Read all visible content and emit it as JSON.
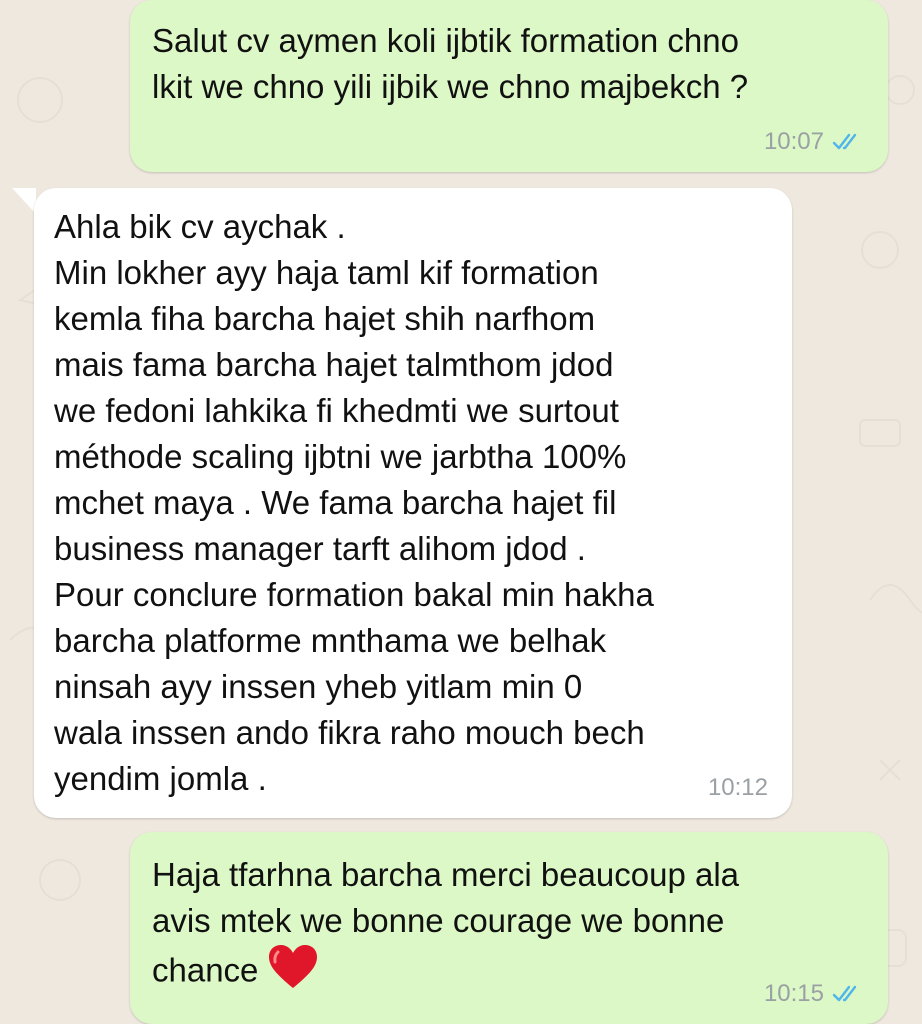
{
  "chat": {
    "messages": [
      {
        "direction": "outgoing",
        "text": "Salut cv aymen koli ijbtik formation chno\nlkit we chno yili ijbik we chno majbekch ?",
        "time": "10:07",
        "status_icon": "double-check-read-icon"
      },
      {
        "direction": "incoming",
        "text": "Ahla bik cv aychak .\nMin lokher ayy haja taml kif formation\nkemla fiha barcha hajet shih narfhom\nmais fama barcha hajet talmthom jdod\nwe fedoni lahkika fi khedmti we surtout\nméthode scaling ijbtni we jarbtha 100%\nmchet maya . We fama barcha hajet fil\nbusiness manager tarft alihom jdod .\nPour conclure formation bakal min hakha\nbarcha platforme mnthama we belhak\nninsah ayy inssen yheb yitlam min 0\nwala inssen ando fikra raho mouch bech\nyendim jomla .",
        "time": "10:12"
      },
      {
        "direction": "outgoing",
        "text": "Haja tfarhna barcha merci beaucoup ala\navis mtek we bonne courage we bonne\nchance",
        "emoji": "red-heart-icon",
        "time": "10:15",
        "status_icon": "double-check-read-icon"
      }
    ]
  },
  "colors": {
    "background": "#efe8df",
    "outgoing_bubble": "#dcf8c6",
    "incoming_bubble": "#ffffff",
    "text": "#111111",
    "timestamp": "#9aa0a4",
    "read_ticks": "#4fb6ec",
    "heart": "#e0162b"
  }
}
